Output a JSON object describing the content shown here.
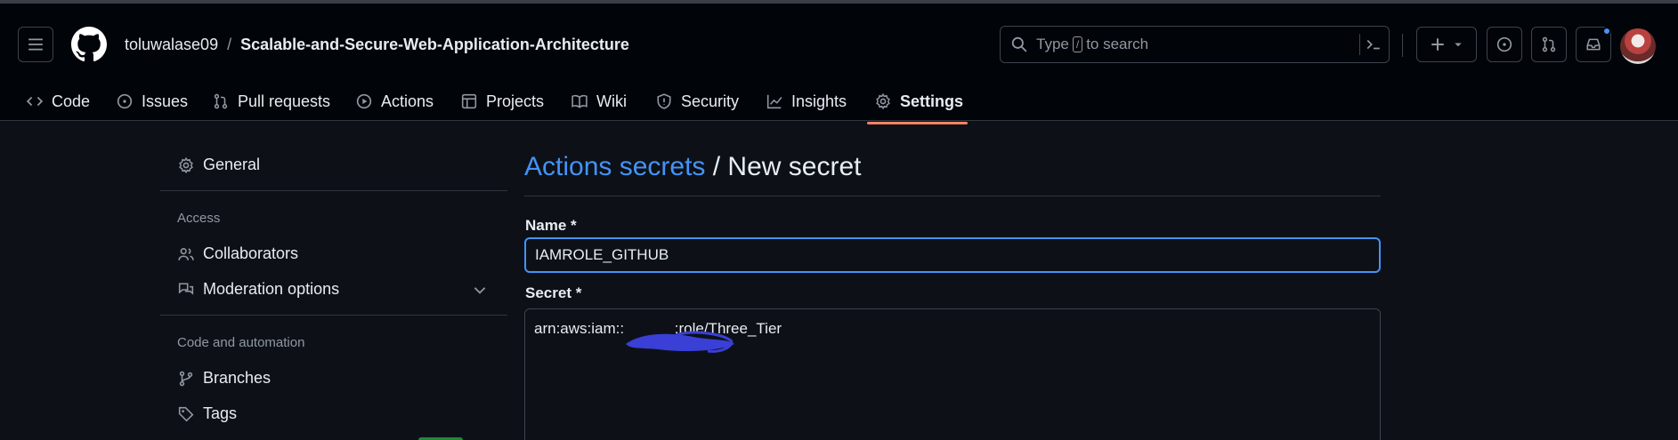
{
  "header": {
    "owner": "toluwalase09",
    "separator": "/",
    "repo": "Scalable-and-Secure-Web-Application-Architecture",
    "search": {
      "prefix": "Type",
      "key": "/",
      "suffix": "to search"
    }
  },
  "tabs": [
    {
      "label": "Code",
      "icon": "code-icon"
    },
    {
      "label": "Issues",
      "icon": "issue-opened-icon"
    },
    {
      "label": "Pull requests",
      "icon": "git-pull-request-icon"
    },
    {
      "label": "Actions",
      "icon": "play-icon"
    },
    {
      "label": "Projects",
      "icon": "table-icon"
    },
    {
      "label": "Wiki",
      "icon": "book-icon"
    },
    {
      "label": "Security",
      "icon": "shield-icon"
    },
    {
      "label": "Insights",
      "icon": "graph-icon"
    },
    {
      "label": "Settings",
      "icon": "gear-icon",
      "active": true
    }
  ],
  "sidebar": {
    "general": "General",
    "access_heading": "Access",
    "collaborators": "Collaborators",
    "moderation": "Moderation options",
    "code_heading": "Code and automation",
    "branches": "Branches",
    "tags": "Tags"
  },
  "main": {
    "title_link": "Actions secrets",
    "title_rest": "/ New secret",
    "name_label": "Name *",
    "name_value": "IAMROLE_GITHUB",
    "secret_label": "Secret *",
    "secret_value": "arn:aws:iam::            :role/Three_Tier"
  },
  "colors": {
    "accent": "#4493f8",
    "active_tab": "#f78166",
    "background": "#0d1117",
    "header": "#010409",
    "redaction": "#3a3fd6"
  }
}
